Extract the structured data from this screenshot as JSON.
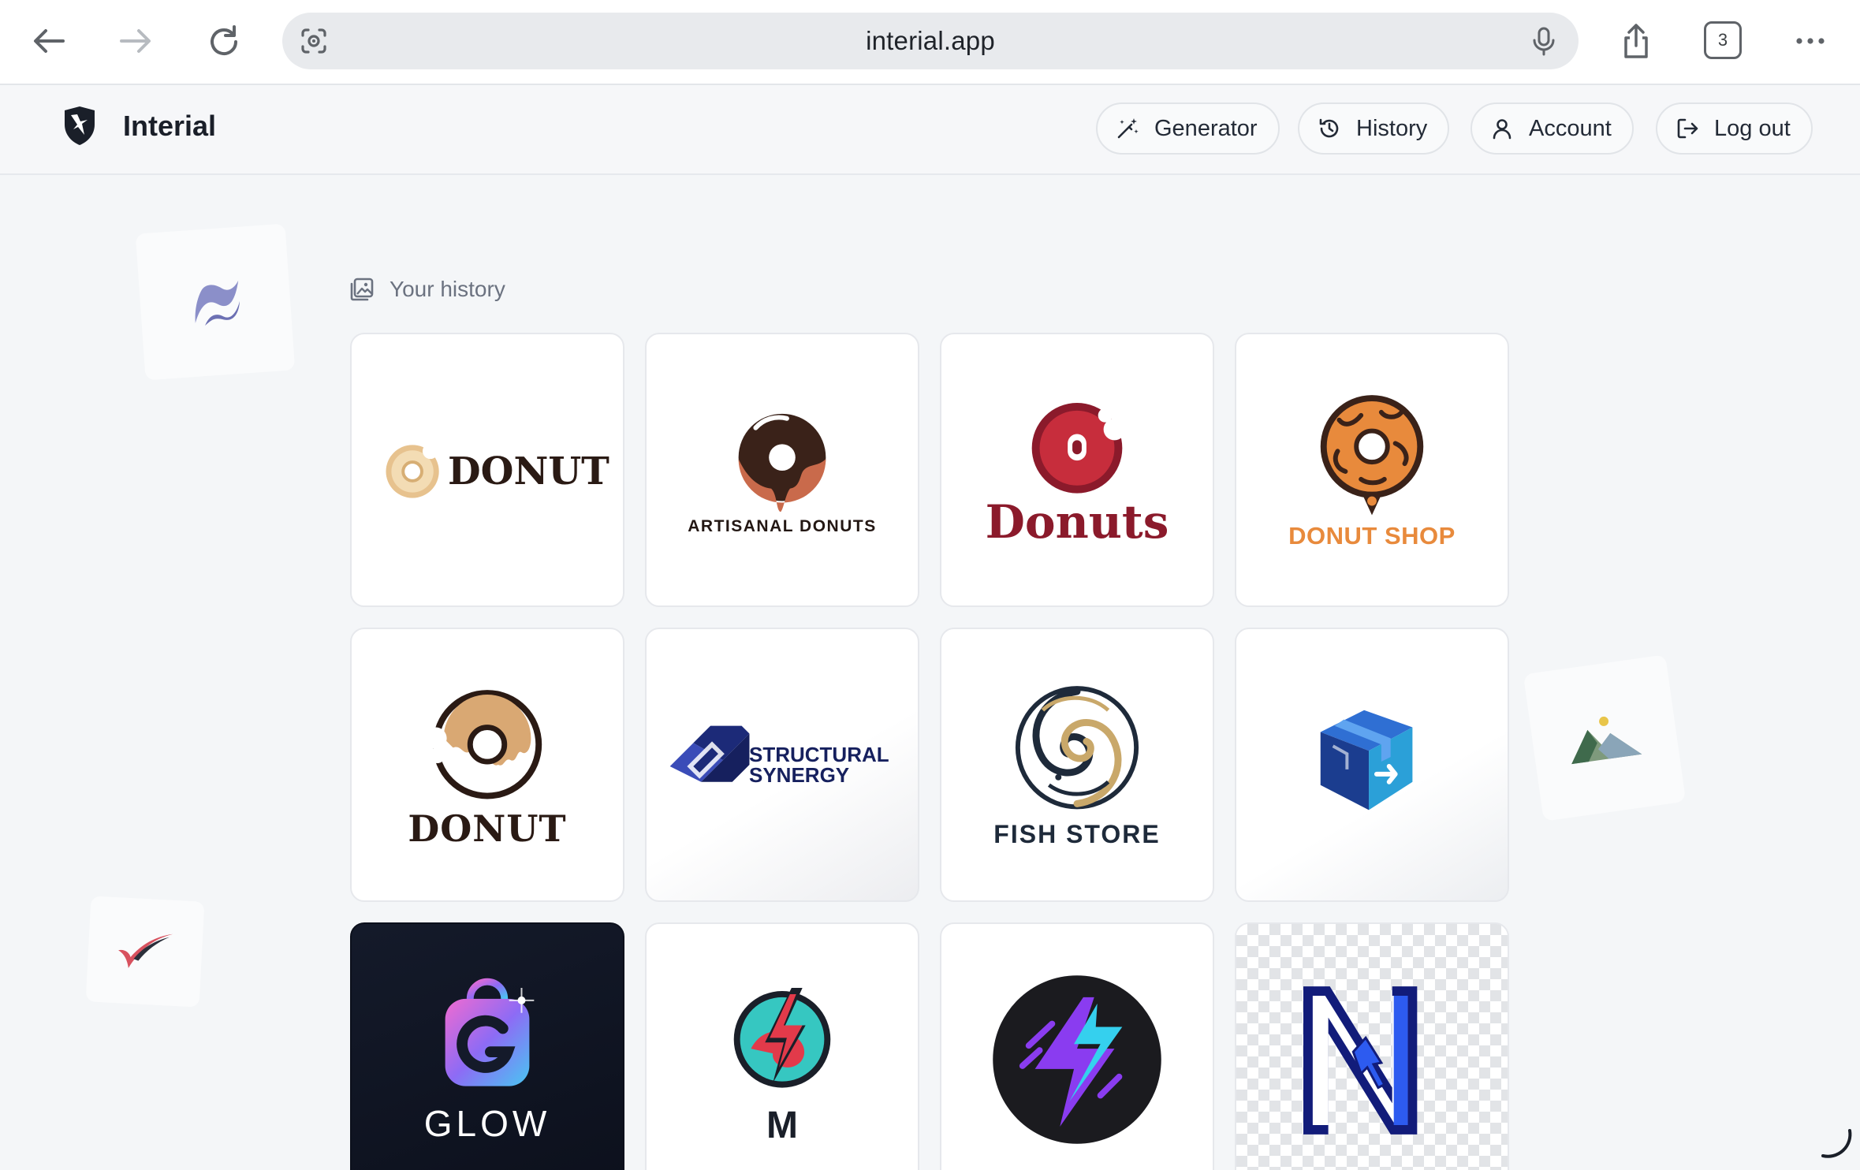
{
  "browser": {
    "url": "interial.app",
    "tab_count": "3",
    "icons": [
      "back-arrow-icon",
      "forward-arrow-icon",
      "reload-icon",
      "lens-icon",
      "mic-icon",
      "share-icon",
      "tabs-icon",
      "more-icon"
    ]
  },
  "app": {
    "brand": "Interial",
    "nav": {
      "generator": "Generator",
      "history": "History",
      "account": "Account",
      "logout": "Log out"
    }
  },
  "history": {
    "heading": "Your history",
    "items": [
      {
        "text": "DONUT"
      },
      {
        "text": "ARTISANAL DONUTS"
      },
      {
        "text": "Donuts"
      },
      {
        "text": "DONUT SHOP"
      },
      {
        "text": "DONUT"
      },
      {
        "line1": "STRUCTURAL",
        "line2": "SYNERGY"
      },
      {
        "text": "FISH STORE"
      },
      {
        "text": ""
      },
      {
        "text": "GLOW"
      },
      {
        "text": "M"
      },
      {
        "text": ""
      },
      {
        "text": ""
      }
    ]
  },
  "colors": {
    "accent_dark": "#1a1f29",
    "donut_brown": "#2a1a14",
    "donut_red": "#8b1a2b",
    "donut_orange": "#e88a3c",
    "navy": "#1c2a78"
  }
}
